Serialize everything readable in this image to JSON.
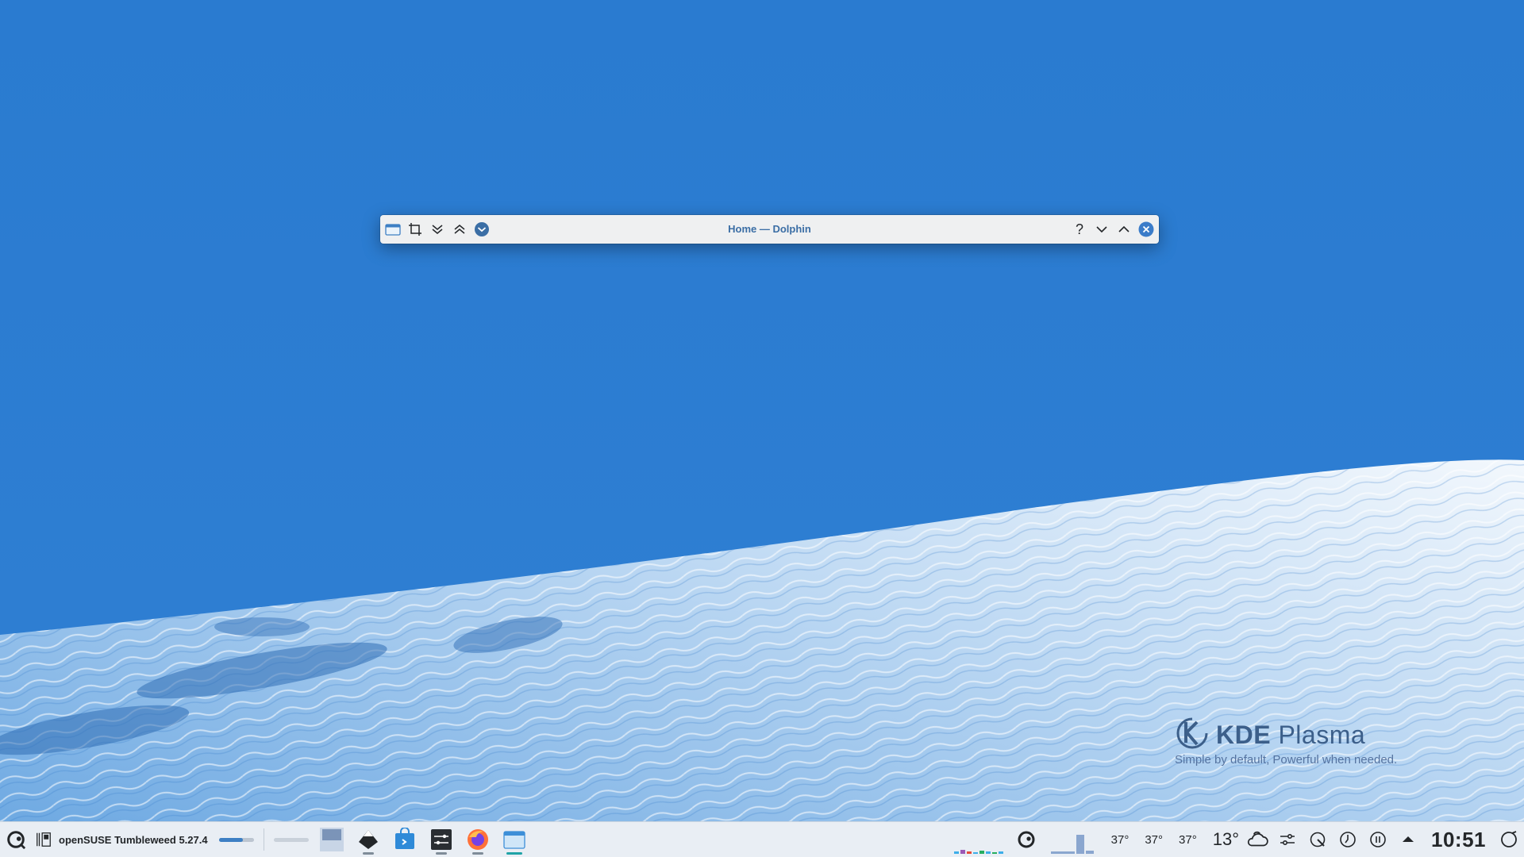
{
  "window": {
    "title": "Home — Dolphin",
    "app_icon": "folder-blue-icon",
    "left_buttons": [
      "crop-icon",
      "chevrons-down-icon",
      "chevrons-up-icon",
      "menu-circle-icon"
    ],
    "right_buttons": [
      "help-icon",
      "minimize-icon",
      "maximize-icon",
      "close-icon"
    ],
    "help_label": "?"
  },
  "brand": {
    "kde": "KDE",
    "plasma": "Plasma",
    "tagline": "Simple by default, Powerful when  needed."
  },
  "taskbar": {
    "global_menu_title": "openSUSE Tumbleweed 5.27.4",
    "volume_level": 0.7,
    "tasks": [
      {
        "name": "desktop-pager",
        "icon": "pager-icon"
      },
      {
        "name": "inkscape",
        "icon": "inkscape-icon"
      },
      {
        "name": "discover",
        "icon": "store-icon"
      },
      {
        "name": "system-settings",
        "icon": "settings-icon"
      },
      {
        "name": "firefox",
        "icon": "firefox-icon"
      },
      {
        "name": "dolphin",
        "icon": "folder-icon"
      }
    ],
    "temps": [
      "37°",
      "37°",
      "37°"
    ],
    "weather_temp": "13°",
    "clock": "10:51"
  },
  "colors": {
    "wallpaper_sky": "#2a7bd0",
    "accent": "#3d7fc4",
    "close": "#3b7cc9",
    "active_task": "#1fa3a7"
  }
}
